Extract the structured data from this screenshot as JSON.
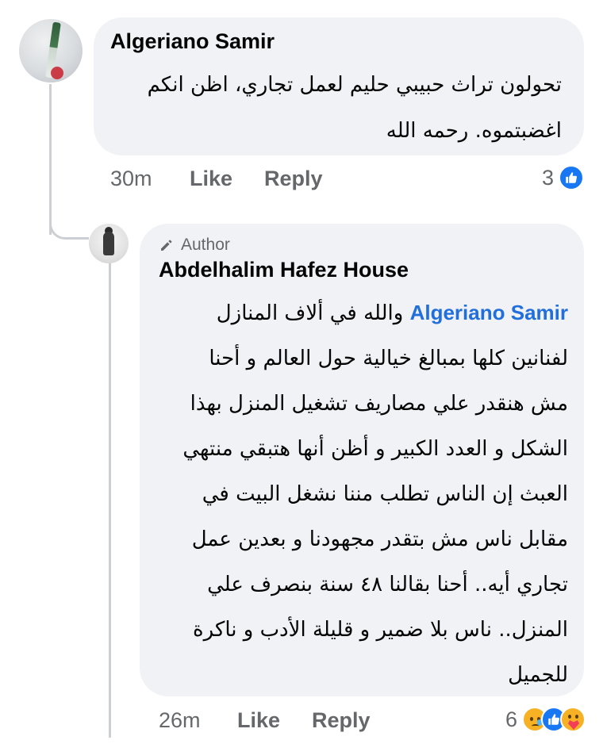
{
  "comment": {
    "author": "Algeriano Samir",
    "text_lines": [
      "تحولون تراث حبيبي حليم لعمل تجاري، اظن انكم",
      "اغضبتموه. رحمه الله"
    ],
    "time": "30m",
    "like_label": "Like",
    "reply_label": "Reply",
    "reaction_count": "3",
    "reaction_icons": [
      "like-icon"
    ]
  },
  "reply": {
    "badge_label": "Author",
    "badge_icon": "pen-icon",
    "author": "Abdelhalim Hafez House",
    "mention": "Algeriano Samir",
    "first_line_after_mention": "والله في ألاف المنازل",
    "text_lines": [
      "لفنانين كلها بمبالغ خيالية حول العالم و أحنا",
      "مش هنقدر علي مصاريف تشغيل المنزل بهذا",
      "الشكل و العدد الكبير و أظن أنها هتبقي منتهي",
      "العبث إن الناس تطلب مننا نشغل البيت في",
      "مقابل ناس مش بتقدر مجهودنا و بعدين عمل",
      "تجاري أيه.. أحنا بقالنا ٤٨ سنة بنصرف علي",
      "المنزل.. ناس بلا ضمير و قليلة الأدب و ناكرة",
      "للجميل"
    ],
    "time": "26m",
    "like_label": "Like",
    "reply_label": "Reply",
    "reaction_count": "6",
    "reaction_icons": [
      "sad-icon",
      "like-icon",
      "care-icon"
    ]
  },
  "colors": {
    "bubble_bg": "#f0f2f5",
    "mention": "#216fdb",
    "meta_text": "#65676b",
    "like_blue": "#1877f2"
  }
}
